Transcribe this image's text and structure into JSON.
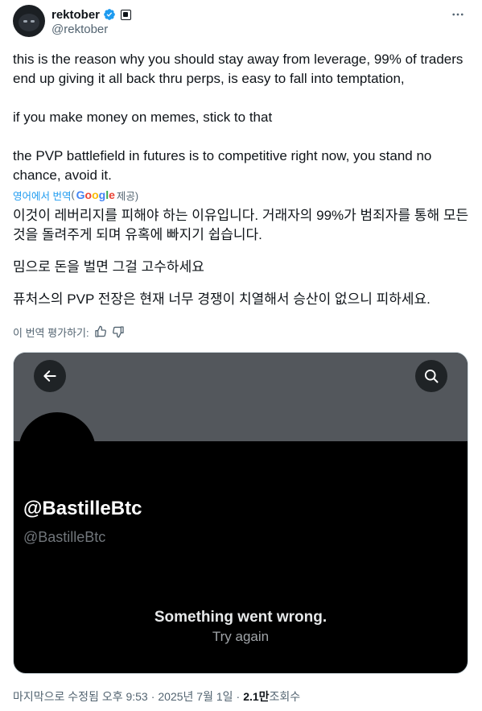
{
  "author": {
    "display_name": "rektober",
    "handle": "@rektober"
  },
  "tweet": {
    "paragraphs": [
      "this is the reason why you should stay away from leverage, 99% of traders end up giving it all back thru perps, is easy to fall into temptation,",
      "if you make money on memes, stick to that",
      "the PVP battlefield in futures is to competitive right now, you stand no chance, avoid it."
    ]
  },
  "translation": {
    "link_label": "영어에서 번역",
    "open_paren": "(",
    "provider": "Google",
    "provided_label": " 제공)",
    "paragraphs": [
      "이것이 레버리지를 피해야 하는 이유입니다. 거래자의 99%가 범죄자를 통해 모든 것을 돌려주게 되며 유혹에 빠지기 쉽습니다.",
      "밈으로 돈을 벌면 그걸 고수하세요",
      "퓨처스의 PVP 전장은 현재 너무 경쟁이 치열해서 승산이 없으니 피하세요."
    ],
    "rate_label": "이 번역 평가하기:"
  },
  "embedded_card": {
    "profile_name": "@BastilleBtc",
    "profile_handle": "@BastilleBtc",
    "error_message": "Something went wrong.",
    "retry_label": "Try again"
  },
  "meta": {
    "edited_label": "마지막으로 수정됨 오후 9:53",
    "separator": "·",
    "date": "2025년 7월 1일",
    "views_count": "2.1만",
    "views_label": " 조회수"
  },
  "colors": {
    "accent": "#1d9bf0",
    "secondary_text": "#536471",
    "card_background": "#000000",
    "banner": "#53575c"
  },
  "icons": [
    "verified-badge-icon",
    "more-options-icon",
    "thumbs-up-icon",
    "thumbs-down-icon",
    "back-arrow-icon",
    "search-icon"
  ]
}
